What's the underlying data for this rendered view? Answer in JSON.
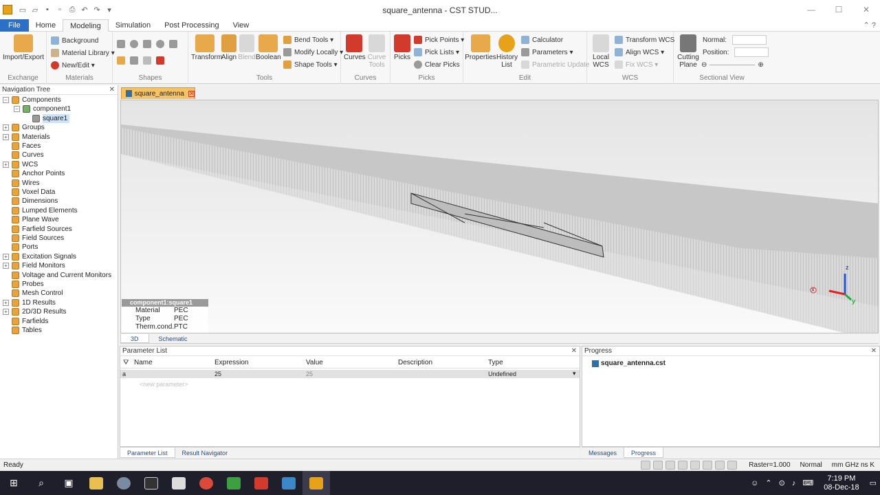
{
  "window": {
    "title": "square_antenna - CST STUD...",
    "controls": {
      "minimize": "—",
      "maximize": "☐",
      "close": "✕"
    }
  },
  "ribbon_tabs": [
    "File",
    "Home",
    "Modeling",
    "Simulation",
    "Post Processing",
    "View"
  ],
  "ribbon": {
    "exchange": {
      "label": "Exchange",
      "import_export": "Import/Export"
    },
    "materials": {
      "label": "Materials",
      "background": "Background",
      "material_library": "Material Library ▾",
      "new_edit": "New/Edit ▾"
    },
    "shapes": {
      "label": "Shapes"
    },
    "tools": {
      "label": "Tools",
      "transform": "Transform",
      "align": "Align",
      "blend": "Blend",
      "boolean": "Boolean",
      "bend_tools": "Bend Tools ▾",
      "modify_locally": "Modify Locally ▾",
      "shape_tools": "Shape Tools ▾"
    },
    "curves": {
      "label": "Curves",
      "curves": "Curves",
      "curve_tools": "Curve Tools"
    },
    "picks": {
      "label": "Picks",
      "picks": "Picks",
      "pick_points": "Pick Points ▾",
      "pick_lists": "Pick Lists ▾",
      "clear_picks": "Clear Picks"
    },
    "edit": {
      "label": "Edit",
      "properties": "Properties",
      "history_list": "History List",
      "calculator": "Calculator",
      "parameters": "Parameters ▾",
      "parametric_update": "Parametric Update"
    },
    "wcs": {
      "label": "WCS",
      "local_wcs": "Local WCS",
      "transform_wcs": "Transform WCS",
      "align_wcs": "Align WCS ▾",
      "fix_wcs": "Fix WCS ▾"
    },
    "sectional": {
      "label": "Sectional View",
      "cutting_plane": "Cutting Plane",
      "normal": "Normal:",
      "position": "Position:"
    }
  },
  "nav_tree": {
    "title": "Navigation Tree",
    "items": [
      "Components",
      "component1",
      "square1",
      "Groups",
      "Materials",
      "Faces",
      "Curves",
      "WCS",
      "Anchor Points",
      "Wires",
      "Voxel Data",
      "Dimensions",
      "Lumped Elements",
      "Plane Wave",
      "Farfield Sources",
      "Field Sources",
      "Ports",
      "Excitation Signals",
      "Field Monitors",
      "Voltage and Current Monitors",
      "Probes",
      "Mesh Control",
      "1D Results",
      "2D/3D Results",
      "Farfields",
      "Tables"
    ]
  },
  "document_tab": "square_antenna",
  "viewport": {
    "props_title": "component1:square1",
    "props": [
      {
        "key": "Material",
        "value": "PEC"
      },
      {
        "key": "Type",
        "value": "PEC"
      },
      {
        "key": "Therm.cond.",
        "value": "PTC"
      }
    ],
    "axes": {
      "z": "z",
      "y": "y",
      "x": "x"
    },
    "view_tabs": [
      "3D",
      "Schematic"
    ]
  },
  "param_list": {
    "title": "Parameter List",
    "columns": [
      "Name",
      "Expression",
      "Value",
      "Description",
      "Type"
    ],
    "rows": [
      {
        "name": "a",
        "expression": "25",
        "value": "25",
        "description": "",
        "type": "Undefined"
      }
    ],
    "new_placeholder": "<new parameter>",
    "tabs": [
      "Parameter List",
      "Result Navigator"
    ]
  },
  "progress": {
    "title": "Progress",
    "item": "square_antenna.cst",
    "tabs": [
      "Messages",
      "Progress"
    ]
  },
  "status": {
    "left": "Ready",
    "raster": "Raster=1.000",
    "mode": "Normal",
    "units": "mm  GHz  ns  K"
  },
  "taskbar": {
    "time": "7:19 PM",
    "date": "08-Dec-18"
  },
  "colors": {
    "file_tab": "#2b6fc7",
    "doc_tab": "#f7c262",
    "taskbar": "#1f1f2c"
  }
}
